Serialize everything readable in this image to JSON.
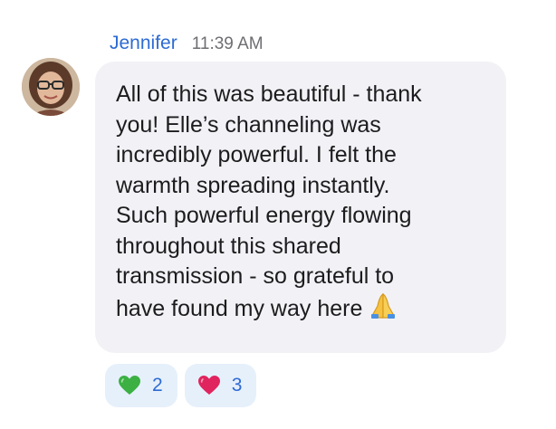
{
  "message": {
    "sender": "Jennifer",
    "time": "11:39 AM",
    "text_lines": [
      "All of this was beautiful - thank",
      "you! Elle’s channeling was",
      "incredibly powerful. I felt the",
      "warmth spreading instantly.",
      "Such powerful energy flowing",
      "throughout this shared",
      "transmission - so grateful to",
      "have found my way here"
    ],
    "text_emoji": "folded-hands-icon"
  },
  "reactions": [
    {
      "icon": "green-heart-icon",
      "count": "2"
    },
    {
      "icon": "red-heart-icon",
      "count": "3"
    }
  ],
  "colors": {
    "sender": "#2d6bd3",
    "bubble": "#f2f2f6",
    "reaction_bg": "#e6f0fb",
    "green_heart": "#3cb043",
    "red_heart": "#e0245e"
  }
}
